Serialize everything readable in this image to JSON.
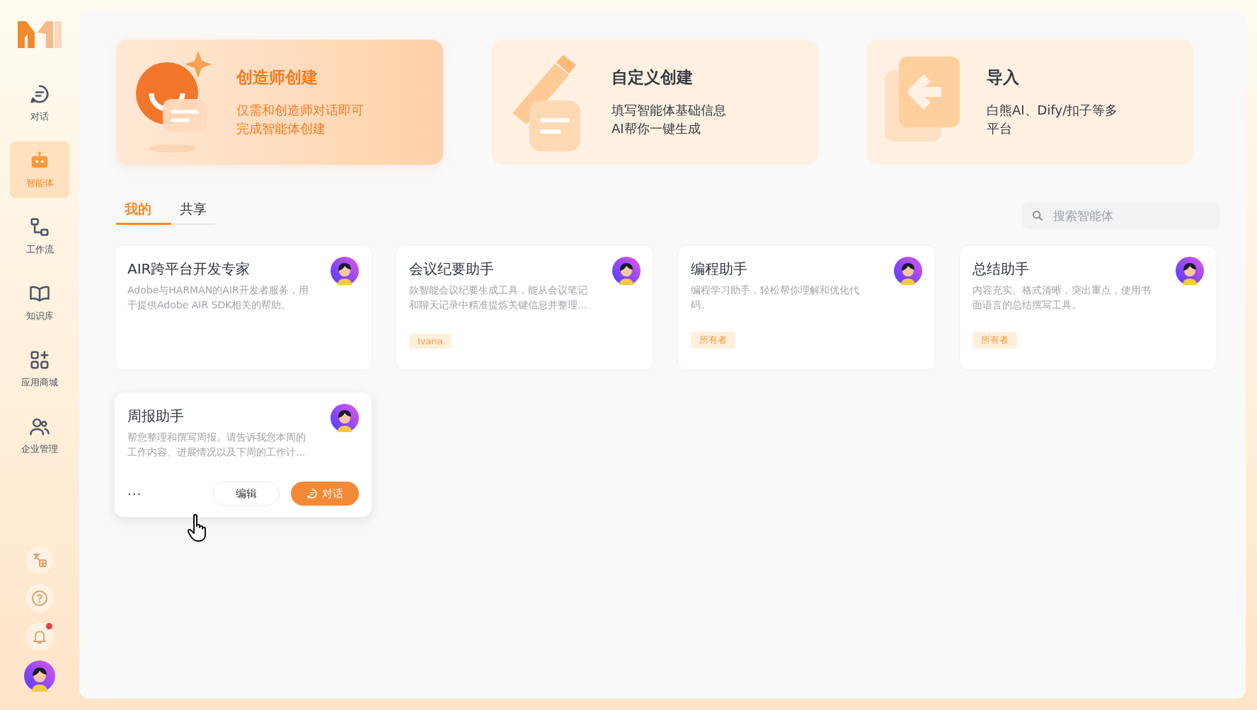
{
  "sidebar": {
    "items": [
      {
        "kind": "chat",
        "label": "对话",
        "selected": false
      },
      {
        "kind": "robot",
        "label": "智能体",
        "selected": true
      },
      {
        "kind": "flow",
        "label": "工作流",
        "selected": false
      },
      {
        "kind": "book",
        "label": "知识库",
        "selected": false
      },
      {
        "kind": "apps",
        "label": "应用商城",
        "selected": false
      },
      {
        "kind": "users",
        "label": "企业管理",
        "selected": false
      }
    ],
    "bottom": [
      {
        "kind": "translate",
        "badge": false
      },
      {
        "kind": "help",
        "badge": false
      },
      {
        "kind": "bell",
        "badge": true
      }
    ]
  },
  "create_cards": [
    {
      "kind": "creator",
      "title": "创造师创建",
      "description": "仅需和创造师对话即可完成智能体创建",
      "highlighted": true
    },
    {
      "kind": "custom",
      "title": "自定义创建",
      "description": "填写智能体基础信息AI帮你一键生成",
      "highlighted": false
    },
    {
      "kind": "import",
      "title": "导入",
      "description": "白熊AI、Dify/扣子等多平台",
      "highlighted": false
    }
  ],
  "tabs": [
    {
      "label": "我的",
      "selected": true
    },
    {
      "label": "共享",
      "selected": false
    }
  ],
  "search": {
    "placeholder": "搜索智能体"
  },
  "agents": [
    {
      "name": "AIR跨平台开发专家",
      "description": "Adobe与HARMAN的AIR开发者服务，用于提供Adobe AIR SDK相关的帮助。",
      "hovered": false
    },
    {
      "name": "会议纪要助手",
      "description": "款智能会议纪要生成工具，能从会议笔记和聊天记录中精准提炼关键信息并整理...",
      "tag": "Ivana",
      "hovered": false
    },
    {
      "name": "编程助手",
      "description": "编程学习助手，轻松帮你理解和优化代码。",
      "tag": "所有者",
      "hovered": false
    },
    {
      "name": "总结助手",
      "description": "内容充实、格式清晰，突出重点，使用书面语言的总结撰写工具。",
      "tag": "所有者",
      "hovered": false
    },
    {
      "name": "周报助手",
      "description": "帮您整理和撰写周报。请告诉我您本周的工作内容、进展情况以及下周的工作计...",
      "hovered": true,
      "more": "···",
      "edit_label": "编辑",
      "chat_label": "对话"
    }
  ]
}
